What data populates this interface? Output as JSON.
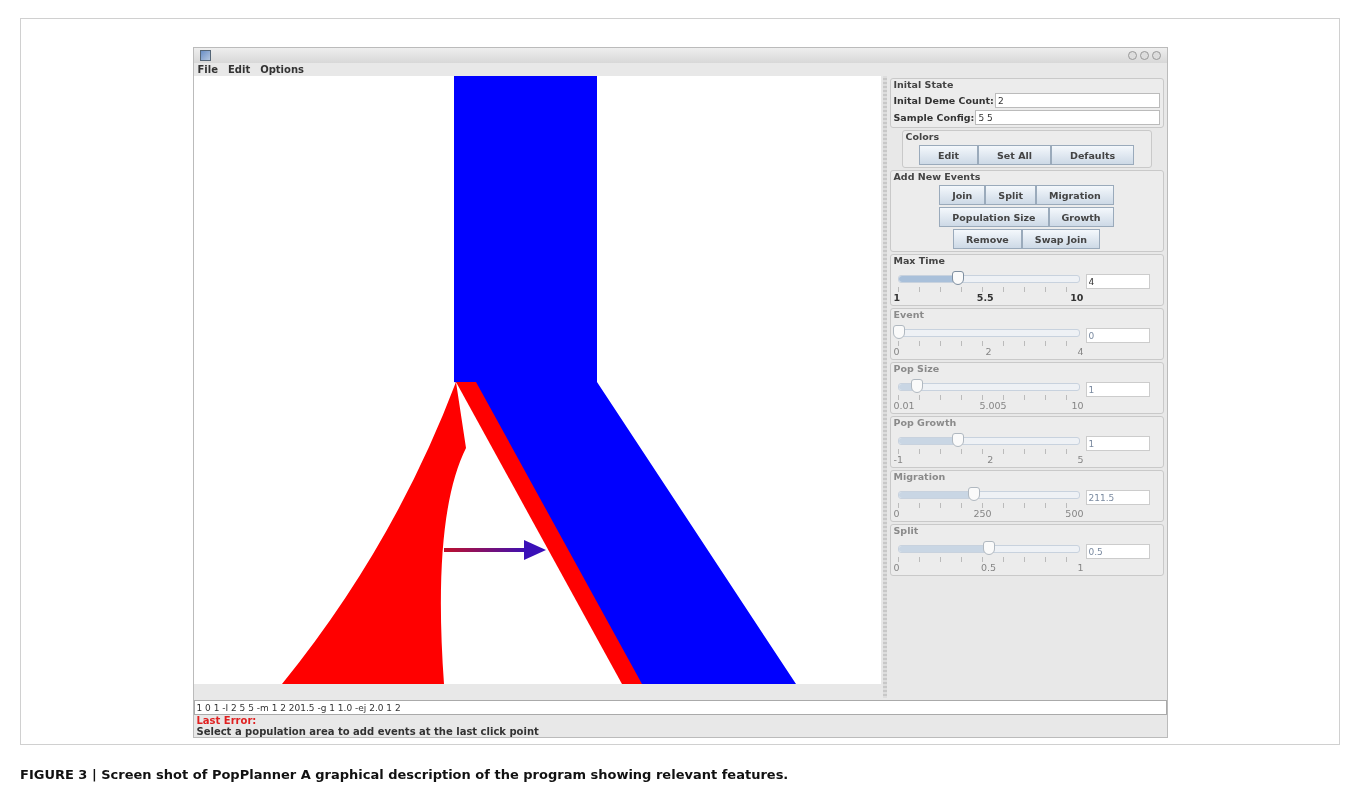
{
  "menu": [
    "File",
    "Edit",
    "Options"
  ],
  "initial_state": {
    "title": "Inital State",
    "fields": [
      {
        "label": "Inital Deme Count:",
        "value": "2"
      },
      {
        "label": "Sample Config:",
        "value": "5 5"
      }
    ]
  },
  "colors": {
    "title": "Colors",
    "buttons": [
      "Edit",
      "Set All",
      "Defaults"
    ]
  },
  "add_events": {
    "title": "Add New Events",
    "rows": [
      [
        "Join",
        "Split",
        "Migration"
      ],
      [
        "Population Size",
        "Growth"
      ],
      [
        "Remove",
        "Swap Join"
      ]
    ]
  },
  "sliders": [
    {
      "title": "Max Time",
      "disabled": false,
      "level": 0.33,
      "ticks": [
        "1",
        "5.5",
        "10"
      ],
      "value": "4"
    },
    {
      "title": "Event",
      "disabled": true,
      "level": 0,
      "ticks": [
        "0",
        "2",
        "4"
      ],
      "value": "0"
    },
    {
      "title": "Pop Size",
      "disabled": true,
      "level": 0.1,
      "ticks": [
        "0.01",
        "5.005",
        "10"
      ],
      "value": "1"
    },
    {
      "title": "Pop Growth",
      "disabled": true,
      "level": 0.33,
      "ticks": [
        "-1",
        "2",
        "5"
      ],
      "value": "1"
    },
    {
      "title": "Migration",
      "disabled": true,
      "level": 0.42,
      "ticks": [
        "0",
        "250",
        "500"
      ],
      "value": "211.5"
    },
    {
      "title": "Split",
      "disabled": true,
      "level": 0.5,
      "ticks": [
        "0",
        "0.5",
        "1"
      ],
      "value": "0.5"
    }
  ],
  "command": {
    "value": "1 0 1 -I 2 5 5 -m 1 2 201.5 -g 1 1.0 -ej 2.0 1 2"
  },
  "error": {
    "label": "Last Error:",
    "message": "Select a population area to add events at the last click point"
  },
  "caption": "FIGURE 3 | Screen shot of PopPlanner A graphical description of the program showing relevant features."
}
